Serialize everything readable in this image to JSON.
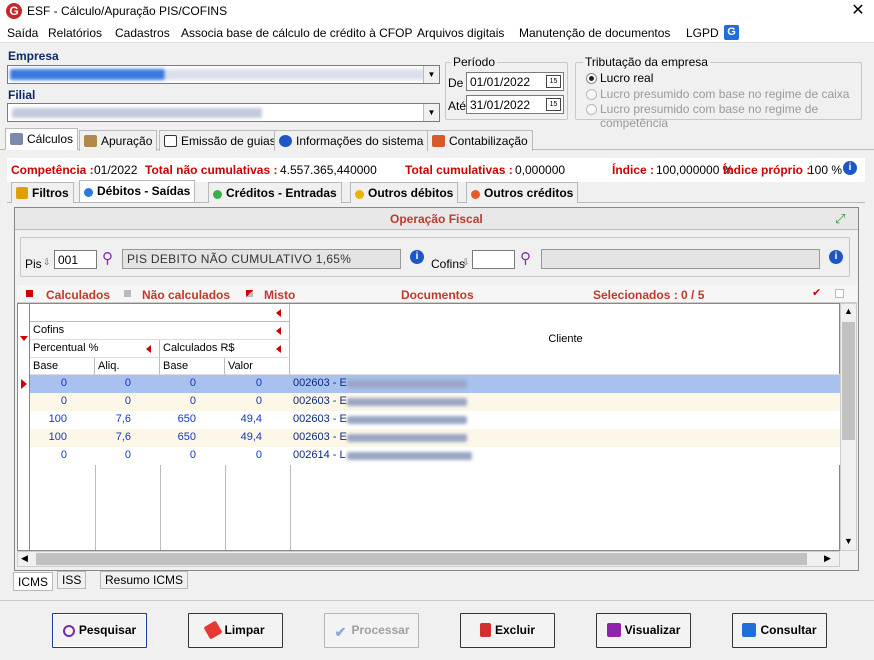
{
  "window": {
    "title": "ESF - Cálculo/Apuração PIS/COFINS",
    "logo": "G"
  },
  "menu": [
    "Saída",
    "Relatórios",
    "Cadastros",
    "Associa base de cálculo de crédito à CFOP",
    "Arquivos digitais",
    "Manutenção de documentos",
    "LGPD"
  ],
  "empresa": {
    "label": "Empresa"
  },
  "filial": {
    "label": "Filial"
  },
  "periodo": {
    "label": "Período",
    "de_label": "De",
    "de": "01/01/2022",
    "ate_label": "Até",
    "ate": "31/01/2022"
  },
  "tributacao": {
    "label": "Tributação da empresa",
    "options": [
      "Lucro real",
      "Lucro presumido com base no regime de caixa",
      "Lucro presumido com base no regime de competência"
    ],
    "selected": "Lucro real"
  },
  "main_tabs": [
    "Cálculos",
    "Apuração",
    "Emissão de guias",
    "Informações do sistema",
    "Contabilização"
  ],
  "status": {
    "competencia_label": "Competência :",
    "competencia": "01/2022",
    "total_nc_label": "Total não cumulativas :",
    "total_nc": "4.557.365,440000",
    "total_c_label": "Total cumulativas :",
    "total_c": "0,000000",
    "indice_label": "Índice :",
    "indice": "100,000000 %",
    "indice_proprio_label": "Índice próprio :",
    "indice_proprio": "100 %"
  },
  "sub_tabs": [
    "Filtros",
    "Débitos - Saídas",
    "Créditos - Entradas",
    "Outros débitos",
    "Outros créditos"
  ],
  "operacao": {
    "title": "Operação Fiscal",
    "pis_label": "Pis",
    "pis_code": "001",
    "pis_desc": "PIS DEBITO NÃO CUMULATIVO 1,65%",
    "cofins_label": "Cofins",
    "cofins_code": "",
    "cofins_desc": ""
  },
  "legend": {
    "calculados": "Calculados",
    "nao_calculados": "Não calculados",
    "misto": "Misto",
    "documentos": "Documentos",
    "selecionados": "Selecionados : 0 / 5"
  },
  "grid": {
    "band1": "Cofins",
    "band2a": "Percentual %",
    "band2b": "Calculados R$",
    "cols": [
      "Base",
      "Aliq.",
      "Base",
      "Valor"
    ],
    "cliente": "Cliente",
    "rows": [
      {
        "base": "0",
        "aliq": "0",
        "base2": "0",
        "valor": "0",
        "doc": "002603 - E"
      },
      {
        "base": "0",
        "aliq": "0",
        "base2": "0",
        "valor": "0",
        "doc": "002603 - E"
      },
      {
        "base": "100",
        "aliq": "7,6",
        "base2": "650",
        "valor": "49,4",
        "doc": "002603 - E"
      },
      {
        "base": "100",
        "aliq": "7,6",
        "base2": "650",
        "valor": "49,4",
        "doc": "002603 - E"
      },
      {
        "base": "0",
        "aliq": "0",
        "base2": "0",
        "valor": "0",
        "doc": "002614 - L"
      }
    ]
  },
  "bottom_tabs": [
    "ICMS",
    "ISS",
    "Resumo ICMS"
  ],
  "buttons": {
    "pesquisar": "Pesquisar",
    "limpar": "Limpar",
    "processar": "Processar",
    "excluir": "Excluir",
    "visualizar": "Visualizar",
    "consultar": "Consultar"
  }
}
